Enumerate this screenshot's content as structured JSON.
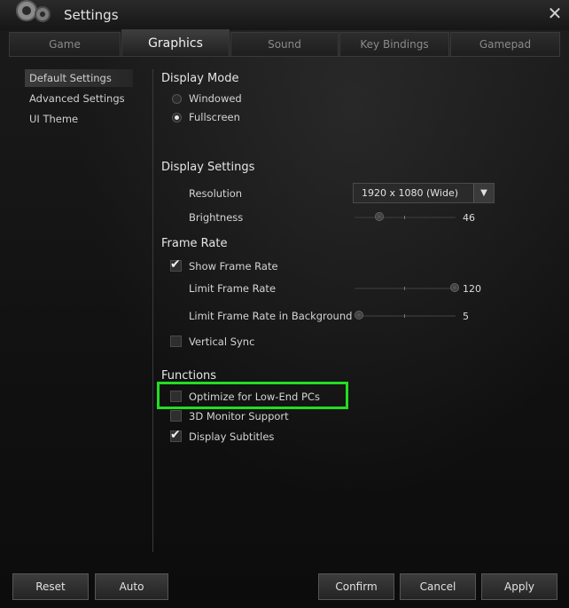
{
  "window": {
    "title": "Settings",
    "close_glyph": "✕"
  },
  "tabs": [
    {
      "label": "Game"
    },
    {
      "label": "Graphics"
    },
    {
      "label": "Sound"
    },
    {
      "label": "Key Bindings"
    },
    {
      "label": "Gamepad"
    }
  ],
  "active_tab": "Graphics",
  "sidebar": {
    "items": [
      {
        "label": "Default Settings"
      },
      {
        "label": "Advanced Settings"
      },
      {
        "label": "UI Theme"
      }
    ],
    "selected": "Default Settings"
  },
  "display_mode": {
    "heading": "Display Mode",
    "options": [
      {
        "label": "Windowed"
      },
      {
        "label": "Fullscreen"
      }
    ],
    "selected": "Fullscreen"
  },
  "display_settings": {
    "heading": "Display Settings",
    "resolution_label": "Resolution",
    "resolution_value": "1920 x 1080 (Wide)",
    "brightness_label": "Brightness",
    "brightness_value": "46"
  },
  "frame_rate": {
    "heading": "Frame Rate",
    "show_frame_rate_label": "Show Frame Rate",
    "show_frame_rate_checked": true,
    "limit_label": "Limit Frame Rate",
    "limit_value": "120",
    "limit_bg_label": "Limit Frame Rate in Background",
    "limit_bg_value": "5",
    "vsync_label": "Vertical Sync",
    "vsync_checked": false
  },
  "functions": {
    "heading": "Functions",
    "low_end_label": "Optimize for Low-End PCs",
    "low_end_checked": false,
    "monitor_3d_label": "3D Monitor Support",
    "monitor_3d_checked": false,
    "subtitles_label": "Display Subtitles",
    "subtitles_checked": true
  },
  "buttons": {
    "reset": "Reset",
    "auto": "Auto",
    "confirm": "Confirm",
    "cancel": "Cancel",
    "apply": "Apply"
  },
  "colors": {
    "highlight": "#22dd22"
  },
  "icons": {
    "gear": "gear-icon",
    "dropdown": "chevron-down-icon",
    "check": "checkmark-icon"
  }
}
